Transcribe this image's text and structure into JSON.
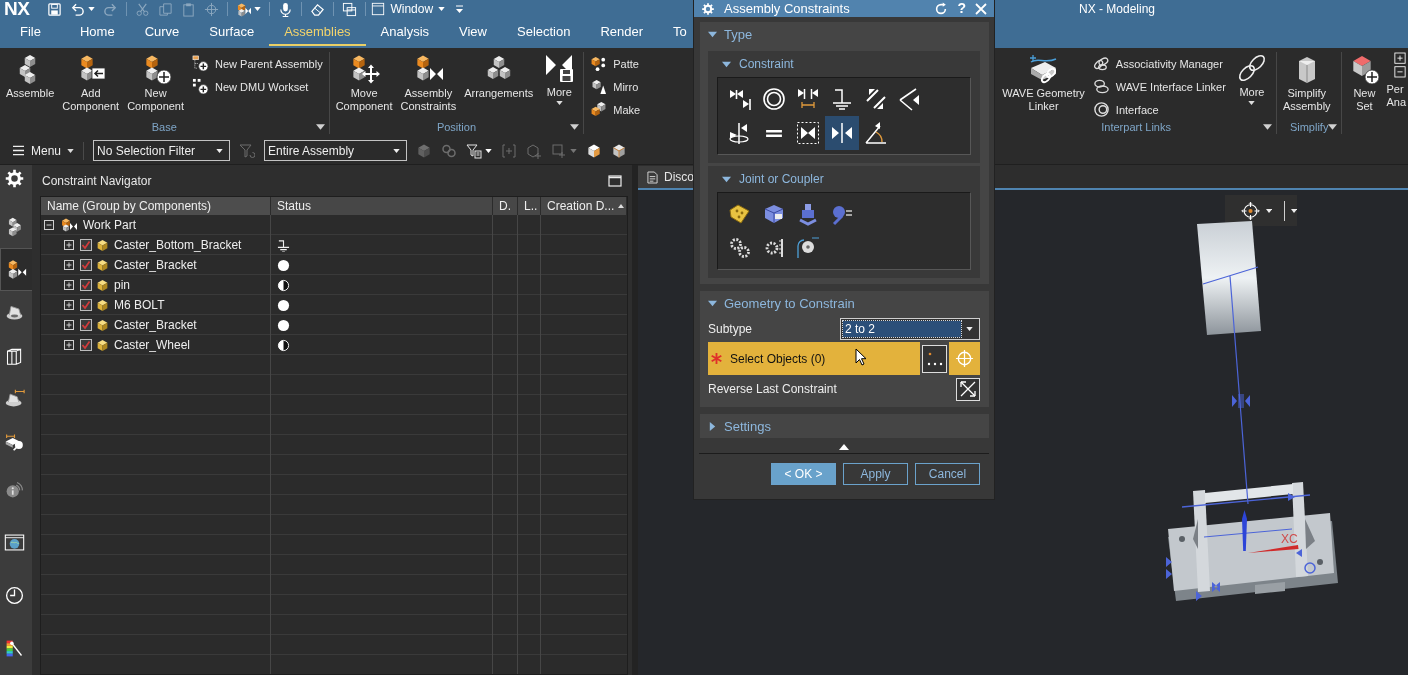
{
  "titlebar": {
    "logo": "NX",
    "title": "NX - Modeling",
    "window_menu": "Window",
    "quick_access": [
      [
        {
          "kind": "save",
          "disabled": false,
          "dropdown": false
        },
        {
          "kind": "undo",
          "disabled": false,
          "dropdown": true
        },
        {
          "kind": "redo",
          "disabled": true,
          "dropdown": false
        }
      ],
      [
        {
          "kind": "cut",
          "disabled": true,
          "dropdown": false
        },
        {
          "kind": "copy",
          "disabled": true,
          "dropdown": false
        },
        {
          "kind": "paste",
          "disabled": true,
          "dropdown": false
        },
        {
          "kind": "transform",
          "disabled": true,
          "dropdown": false
        }
      ],
      [
        {
          "kind": "assembly",
          "disabled": false,
          "dropdown": true
        }
      ],
      [
        {
          "kind": "microphone",
          "disabled": false,
          "dropdown": false
        }
      ],
      [
        {
          "kind": "eraser",
          "disabled": false,
          "dropdown": false
        }
      ],
      [
        {
          "kind": "windows",
          "disabled": false,
          "dropdown": false
        }
      ]
    ]
  },
  "tabs": [
    {
      "label": "File",
      "selected": false
    },
    {
      "label": "Home",
      "selected": false
    },
    {
      "label": "Curve",
      "selected": false
    },
    {
      "label": "Surface",
      "selected": false
    },
    {
      "label": "Assemblies",
      "selected": true
    },
    {
      "label": "Analysis",
      "selected": false
    },
    {
      "label": "View",
      "selected": false
    },
    {
      "label": "Selection",
      "selected": false
    },
    {
      "label": "Render",
      "selected": false
    },
    {
      "label": "To",
      "selected": false
    }
  ],
  "ribbon": {
    "left": [
      {
        "label": "Base",
        "menu": true,
        "items": [
          {
            "kind": "large",
            "label": "Assemble"
          },
          {
            "kind": "large",
            "label": "Add\nComponent"
          },
          {
            "kind": "large",
            "label": "New\nComponent"
          },
          {
            "kind": "stack",
            "items": [
              {
                "label": "New Parent Assembly"
              },
              {
                "label": "New DMU Workset"
              }
            ]
          }
        ]
      },
      {
        "label": "Position",
        "menu": true,
        "items": [
          {
            "kind": "large",
            "label": "Move\nComponent"
          },
          {
            "kind": "large",
            "label": "Assembly\nConstraints"
          },
          {
            "kind": "large",
            "label": "Arrangements"
          },
          {
            "kind": "more",
            "label": "More"
          }
        ]
      },
      {
        "items": [
          {
            "kind": "stack",
            "items": [
              {
                "label": "Patte"
              },
              {
                "label": "Mirro"
              },
              {
                "label": "Make"
              }
            ]
          }
        ]
      }
    ],
    "right": [
      {
        "label": "Interpart Links",
        "menu": true,
        "items": [
          {
            "kind": "large",
            "label": "WAVE Geometry\nLinker"
          },
          {
            "kind": "stack",
            "items": [
              {
                "label": "Associativity Manager"
              },
              {
                "label": "WAVE Interface Linker"
              },
              {
                "label": "Interface"
              }
            ]
          },
          {
            "kind": "more",
            "label": "More"
          }
        ]
      },
      {
        "label": "Simplify",
        "menu": true,
        "items": [
          {
            "kind": "large",
            "label": "Simplify\nAssembly"
          }
        ]
      },
      {
        "items": [
          {
            "kind": "large",
            "label": "New\nSet"
          },
          {
            "kind": "large",
            "label": "Per\nAna"
          }
        ]
      }
    ]
  },
  "toolbar": {
    "menu": "Menu",
    "selection_filter": "No Selection Filter",
    "filter_tool": {
      "disabled": true
    },
    "scope": "Entire Assembly",
    "tools": [
      {
        "kind": "cube",
        "disabled": true,
        "dropdown": false
      },
      {
        "kind": "links",
        "disabled": true,
        "dropdown": false
      },
      {
        "kind": "filter",
        "disabled": false,
        "dropdown": true
      },
      {
        "kind": "bracket",
        "disabled": true,
        "dropdown": false
      },
      {
        "kind": "cubeadd",
        "disabled": true,
        "dropdown": false
      },
      {
        "kind": "rectangle",
        "disabled": true,
        "dropdown": true
      },
      {
        "kind": "shaded",
        "disabled": false,
        "dropdown": false
      },
      {
        "kind": "wireframe",
        "disabled": false,
        "dropdown": false
      }
    ]
  },
  "resource_bar": [
    {
      "kind": "settings",
      "selected": false
    },
    {
      "kind": "assembly",
      "selected": false
    },
    {
      "kind": "constraints",
      "selected": true
    },
    {
      "kind": "part",
      "selected": false
    },
    {
      "kind": "library",
      "selected": false
    },
    {
      "kind": "measure",
      "selected": false
    },
    {
      "kind": "inspect",
      "selected": false
    },
    {
      "kind": "info",
      "selected": false
    },
    {
      "kind": "browser",
      "selected": false
    },
    {
      "kind": "history",
      "selected": false
    },
    {
      "kind": "palette",
      "selected": false
    }
  ],
  "navigator": {
    "title": "Constraint Navigator",
    "columns": [
      {
        "label": "Name (Group by Components)",
        "sorted": false
      },
      {
        "label": "Status",
        "sorted": false
      },
      {
        "label": "D.",
        "sorted": false
      },
      {
        "label": "L..",
        "sorted": false
      },
      {
        "label": "Creation D...",
        "sorted": true
      }
    ],
    "tree": [
      {
        "label": "Work Part",
        "kind": "assembly",
        "expanded": true,
        "children": [
          {
            "label": "Caster_Bottom_Bracket",
            "kind": "grounded",
            "checked": true,
            "expanded": false
          },
          {
            "label": "Caster_Bracket",
            "kind": "constrained",
            "checked": true,
            "expanded": false
          },
          {
            "label": "pin",
            "kind": "partial",
            "checked": true,
            "expanded": false
          },
          {
            "label": "M6 BOLT",
            "kind": "constrained",
            "checked": true,
            "expanded": false
          },
          {
            "label": "Caster_Bracket",
            "kind": "constrained",
            "checked": true,
            "expanded": false
          },
          {
            "label": "Caster_Wheel",
            "kind": "partial",
            "checked": true,
            "expanded": false
          }
        ]
      }
    ]
  },
  "viewport": {
    "tab": "Disco",
    "axis_label": "XC"
  },
  "dialog": {
    "title": "Assembly Constraints",
    "help": "?",
    "type_section": {
      "label": "Type",
      "expanded": true,
      "groups": [
        {
          "label": "Constraint",
          "expanded": true,
          "tools": [
            {
              "selected": false
            },
            {
              "selected": false
            },
            {
              "selected": false
            },
            {
              "selected": false
            },
            {
              "selected": false
            },
            {
              "selected": false
            },
            {
              "selected": false
            },
            {
              "selected": false
            },
            {
              "selected": false
            },
            {
              "selected": true
            },
            {
              "selected": false
            }
          ]
        },
        {
          "label": "Joint or Coupler",
          "expanded": true,
          "tools": [
            {
              "selected": false
            },
            {
              "selected": false
            },
            {
              "selected": false
            },
            {
              "selected": false
            },
            {
              "selected": false
            },
            {
              "selected": false
            },
            {
              "selected": false
            }
          ]
        }
      ]
    },
    "geometry_section": {
      "label": "Geometry to Constrain",
      "expanded": true,
      "subtype": {
        "label": "Subtype",
        "value": "2 to 2",
        "focused": true
      },
      "selection": {
        "label": "Select Objects (0)",
        "required": true,
        "active": true
      },
      "reverse": {
        "label": "Reverse Last Constraint"
      }
    },
    "settings_section": {
      "label": "Settings",
      "expanded": false
    },
    "buttons": [
      {
        "label": "< OK >",
        "default": true
      },
      {
        "label": "Apply",
        "default": false
      },
      {
        "label": "Cancel",
        "default": false
      }
    ]
  }
}
